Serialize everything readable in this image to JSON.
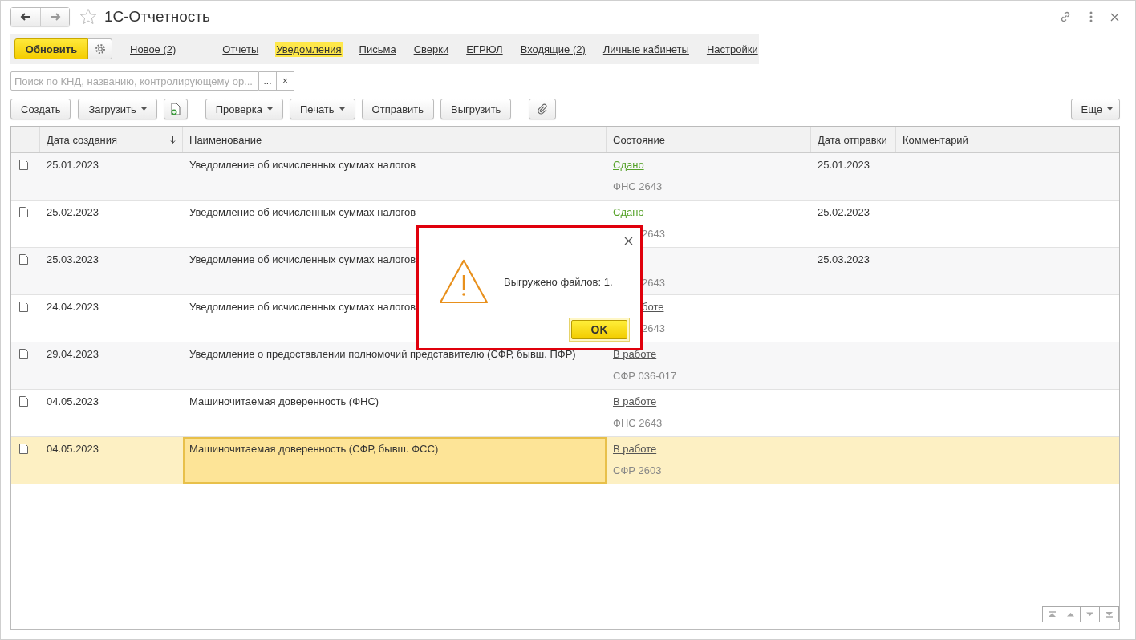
{
  "window": {
    "title": "1С-Отчетность"
  },
  "nav": {
    "refresh": "Обновить",
    "new": "Новое (2)",
    "tabs": [
      {
        "label": "Отчеты",
        "selected": false
      },
      {
        "label": "Уведомления",
        "selected": true
      },
      {
        "label": "Письма",
        "selected": false
      },
      {
        "label": "Сверки",
        "selected": false
      },
      {
        "label": "ЕГРЮЛ",
        "selected": false
      },
      {
        "label": "Входящие (2)",
        "selected": false
      },
      {
        "label": "Личные кабинеты",
        "selected": false
      },
      {
        "label": "Настройки",
        "selected": false
      }
    ]
  },
  "search": {
    "placeholder": "Поиск по КНД, названию, контролирующему ор...",
    "choose": "...",
    "clear": "×"
  },
  "toolbar": [
    {
      "kind": "button",
      "label": "Создать",
      "dropdown": false
    },
    {
      "kind": "button",
      "label": "Загрузить",
      "dropdown": true
    },
    {
      "kind": "add-icon"
    },
    {
      "kind": "button",
      "label": "Проверка",
      "dropdown": true
    },
    {
      "kind": "button",
      "label": "Печать",
      "dropdown": true
    },
    {
      "kind": "button",
      "label": "Отправить",
      "dropdown": false
    },
    {
      "kind": "button",
      "label": "Выгрузить",
      "dropdown": false
    },
    {
      "kind": "clip-icon"
    }
  ],
  "more": "Еще",
  "table": {
    "columns": [
      "Дата создания",
      "Наименование",
      "Состояние",
      "Дата отправки",
      "Комментарий"
    ],
    "rows": [
      {
        "date": "25.01.2023",
        "name": "Уведомление об исчисленных суммах налогов",
        "state": {
          "text": "Сдано",
          "kind": "done"
        },
        "org": {
          "text": "ФНС 2643"
        },
        "sent": "25.01.2023",
        "selected": false
      },
      {
        "date": "25.02.2023",
        "name": "Уведомление об исчисленных суммах налогов",
        "state": {
          "text": "Сдано",
          "kind": "done"
        },
        "org": {
          "text": "2643",
          "partly_hidden": true
        },
        "sent": "25.02.2023",
        "selected": false
      },
      {
        "date": "25.03.2023",
        "name": "Уведомление об исчисленных суммах налогов",
        "org": {
          "text": "2643",
          "partly_hidden": true
        },
        "sent": "25.03.2023",
        "selected": false
      },
      {
        "date": "24.04.2023",
        "name": "Уведомление об исчисленных суммах налогов",
        "state": {
          "text": "боте",
          "kind": "work",
          "partly_hidden": true
        },
        "org": {
          "text": "2643",
          "partly_hidden": true
        },
        "selected": false
      },
      {
        "date": "29.04.2023",
        "name": "Уведомление о предоставлении полномочий представителю (СФР, бывш. ПФР)",
        "state": {
          "text": "В работе",
          "kind": "work"
        },
        "org": {
          "text": "СФР 036-017"
        },
        "selected": false
      },
      {
        "date": "04.05.2023",
        "name": "Машиночитаемая доверенность (ФНС)",
        "state": {
          "text": "В работе",
          "kind": "work"
        },
        "org": {
          "text": "ФНС 2643"
        },
        "selected": false
      },
      {
        "date": "04.05.2023",
        "name": "Машиночитаемая доверенность (СФР, бывш. ФСС)",
        "state": {
          "text": "В работе",
          "kind": "work"
        },
        "org": {
          "text": "СФР 2603"
        },
        "selected": true
      }
    ]
  },
  "dialog": {
    "message": "Выгружено файлов: 1.",
    "ok": "OK"
  }
}
